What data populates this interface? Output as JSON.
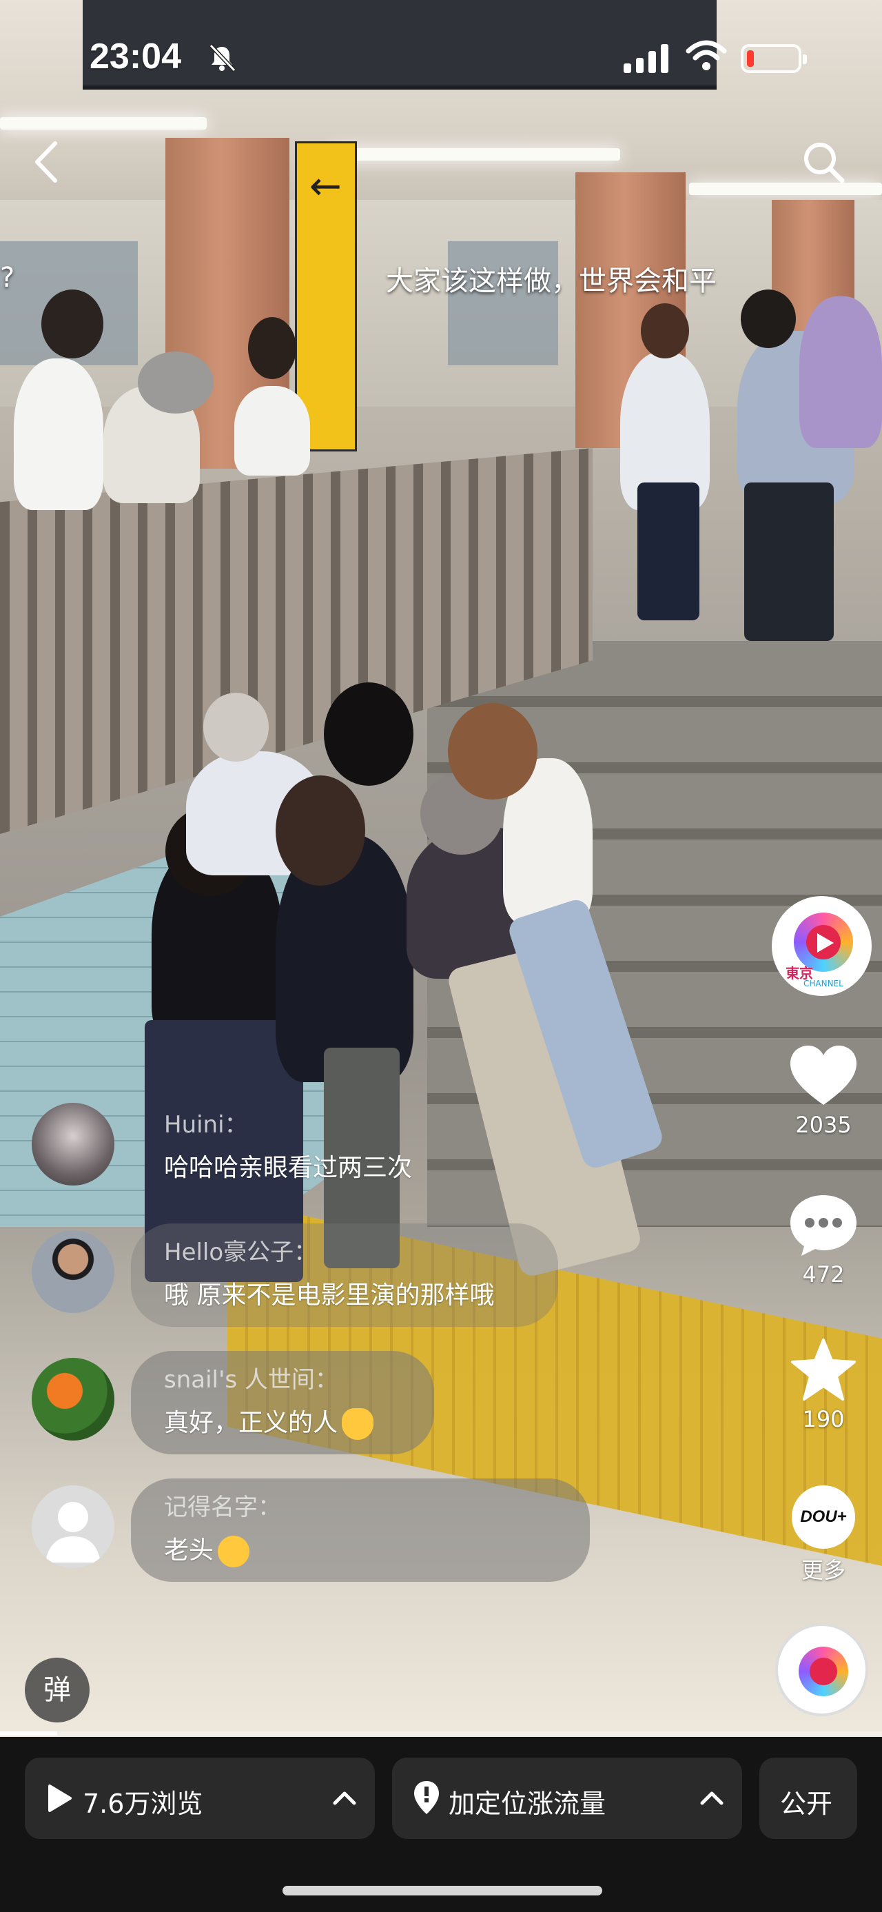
{
  "status_bar": {
    "time": "23:04"
  },
  "video": {
    "caption": "大家该这样做，世界会和平",
    "edge_mark": "?"
  },
  "side_actions": {
    "like_count": "2035",
    "comment_count": "472",
    "favorite_count": "190",
    "more_label": "更多",
    "channel_logo_text": "東京",
    "channel_logo_sub": "CHANNEL",
    "doug_label": "DOU+"
  },
  "comments": [
    {
      "user": "Huini：",
      "text": "哈哈哈亲眼看过两三次"
    },
    {
      "user": "Hello豪公子：",
      "text": "哦 原来不是电影里演的那样哦"
    },
    {
      "user": "snail's 人世间：",
      "text": "真好，正义的人"
    },
    {
      "user": "记得名字：",
      "text": "老头"
    }
  ],
  "danmu_label": "弹",
  "playback": {
    "progress": 0.065
  },
  "bottom_bar": {
    "views_label": "7.6万浏览",
    "location_label": "加定位涨流量",
    "visibility_label": "公开"
  },
  "icons": {
    "back": "back-chevron-icon",
    "search": "search-icon",
    "mute": "bell-slash-icon",
    "like": "heart-icon",
    "comment": "comment-bubble-icon",
    "favorite": "star-icon",
    "play": "play-icon",
    "location": "location-pin-icon",
    "expand": "chevron-up-icon"
  },
  "colors": {
    "battery_low": "#ff3b30",
    "emoji_yellow": "#ffc83d"
  }
}
